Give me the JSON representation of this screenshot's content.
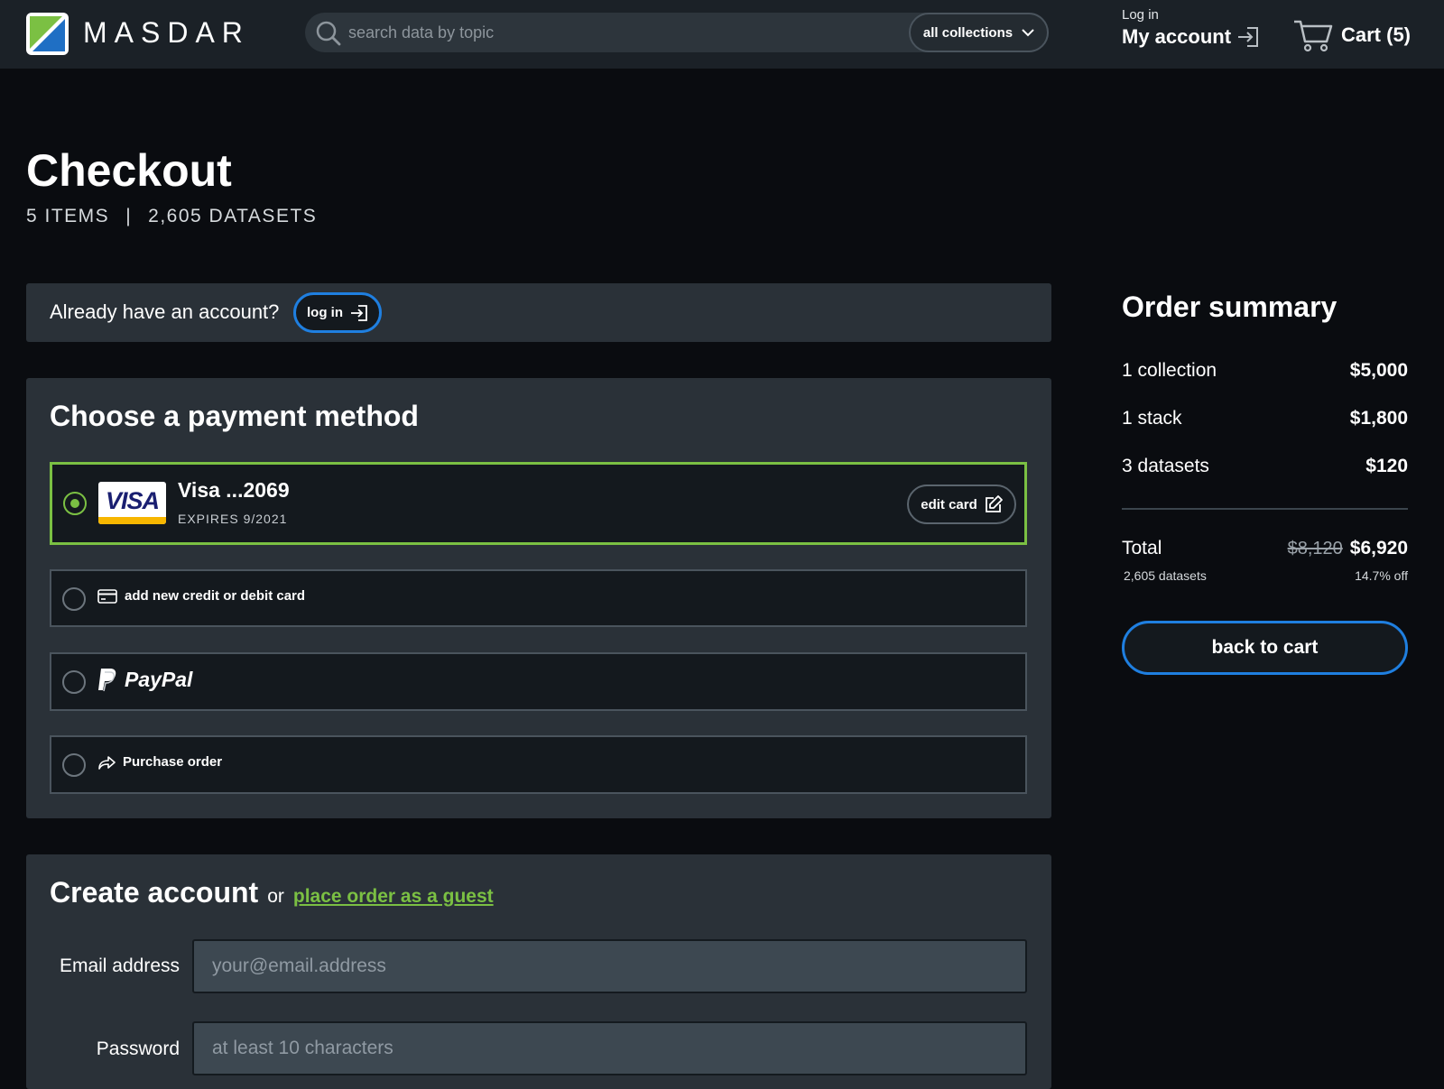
{
  "header": {
    "brand": "MASDAR",
    "search_placeholder": "search data by topic",
    "collections_label": "all collections",
    "login_small": "Log in",
    "account_label": "My account",
    "cart_label": "Cart (5)"
  },
  "page": {
    "title": "Checkout",
    "items": "5 ITEMS",
    "separator": "|",
    "datasets": "2,605 DATASETS"
  },
  "account_prompt": {
    "question": "Already have an account?",
    "login_label": "log in"
  },
  "payment": {
    "heading": "Choose a payment method",
    "visa": {
      "badge": "VISA",
      "name": "Visa ...2069",
      "expires": "EXPIRES 9/2021",
      "edit_label": "edit card",
      "selected": true
    },
    "new_card_label": "add new credit or debit card",
    "paypal_label": "PayPal",
    "purchase_order_label": "Purchase order"
  },
  "create_account": {
    "title": "Create account",
    "or": "or",
    "guest_link": "place order as a guest",
    "email_label": "Email address",
    "email_placeholder": "your@email.address",
    "password_label": "Password",
    "password_placeholder": "at least 10 characters"
  },
  "summary": {
    "title": "Order summary",
    "rows": [
      {
        "label": "1 collection",
        "value": "$5,000"
      },
      {
        "label": "1 stack",
        "value": "$1,800"
      },
      {
        "label": "3 datasets",
        "value": "$120"
      }
    ],
    "total_label": "Total",
    "old_price": "$8,120",
    "new_price": "$6,920",
    "total_datasets": "2,605 datasets",
    "discount": "14.7% off",
    "back_label": "back to cart"
  },
  "colors": {
    "accent_green": "#7bc043",
    "accent_blue": "#1f7fe0",
    "background": "#0a0c10",
    "panel": "#2a3138"
  }
}
